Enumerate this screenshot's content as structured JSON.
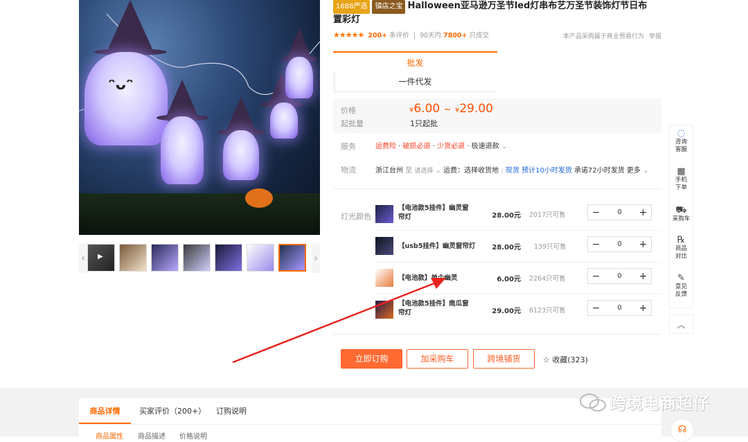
{
  "title": {
    "badge_1688": "1688严选",
    "badge_shop": "镇店之宝",
    "line1": "Halloween亚马逊万圣节led灯串布艺万圣节装饰灯节日布",
    "line2": "置彩灯"
  },
  "rating": {
    "stars": "★★★★★",
    "review_count": "200+",
    "review_label": "条评价",
    "days_label": "90天内",
    "sold_count": "7800+",
    "sold_label": "只成交",
    "notice": "本产品采购属于商业贸易行为",
    "report": "举报"
  },
  "purchase_tabs": {
    "wholesale": "批发",
    "dropship": "一件代发"
  },
  "price": {
    "label": "价格",
    "currency": "¥",
    "low": "6.00",
    "tilde": "~",
    "high": "29.00",
    "moq_label": "起批量",
    "moq_value": "1只起批"
  },
  "service": {
    "label": "服务",
    "items": [
      "运费险",
      "破损必退",
      "少货必退"
    ],
    "extra": "· 极速退款"
  },
  "logistics": {
    "label": "物流",
    "from": "浙江台州",
    "to_label": "至",
    "to_select": "请选择",
    "fee": "运费：选择收货地",
    "stock_tag": "现货",
    "ship_time": "预计10小时发货",
    "promise": "承诺72小时发货",
    "more": "更多"
  },
  "variants": {
    "label": "灯光颜色",
    "rows": [
      {
        "name": "【电池款5挂件】幽灵窗帘灯",
        "price": "28.00元",
        "stock": "2017只可售",
        "qty": "0"
      },
      {
        "name": "【usb5挂件】幽灵窗帘灯",
        "price": "28.00元",
        "stock": "139只可售",
        "qty": "0"
      },
      {
        "name": "【电池款】单个幽灵",
        "price": "6.00元",
        "stock": "2264只可售",
        "qty": "0"
      },
      {
        "name": "【电池款5挂件】南瓜窗帘灯",
        "price": "29.00元",
        "stock": "6123只可售",
        "qty": "0"
      }
    ],
    "minus": "−",
    "plus": "+"
  },
  "actions": {
    "buy_now": "立即订购",
    "add_cart": "加采购车",
    "cross_border": "跨境铺货",
    "favorite": "收藏(323)",
    "favorite_icon": "☆"
  },
  "sidebar": {
    "items": [
      {
        "label1": "咨询",
        "label2": "客服",
        "icon": "chat-icon"
      },
      {
        "label1": "手机",
        "label2": "下单",
        "icon": "qr-icon"
      },
      {
        "label1": "采购车",
        "label2": "",
        "icon": "cart-icon"
      },
      {
        "label1": "商品",
        "label2": "对比",
        "icon": "compare-icon"
      },
      {
        "label1": "意见",
        "label2": "反馈",
        "icon": "edit-icon"
      }
    ],
    "to_top": "︿"
  },
  "detail_tabs": {
    "tabs": [
      "商品详情",
      "买家评价（200+）",
      "订购说明"
    ],
    "subtabs": [
      "商品属性",
      "商品描述",
      "价格说明"
    ]
  },
  "watermark": "跨境电商超仔",
  "colors": {
    "accent": "#ff6a00",
    "price": "#ff5000",
    "arrow": "#e8231f"
  }
}
